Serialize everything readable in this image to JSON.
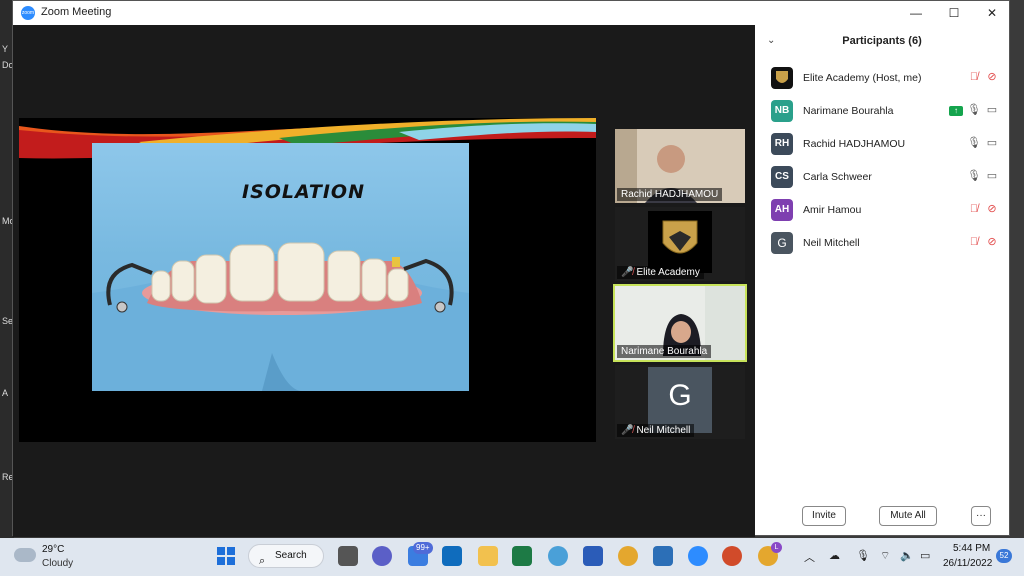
{
  "window": {
    "title": "Zoom Meeting",
    "logo_text": "zoom",
    "minimize": "—",
    "maximize": "☐",
    "close": "✕"
  },
  "desktop_labels": [
    "Y",
    "Do",
    "Mo",
    "Se",
    "A",
    "Re"
  ],
  "slide": {
    "title": "ISOLATION"
  },
  "video_tiles": [
    {
      "name": "Rachid HADJHAMOU",
      "muted": false
    },
    {
      "name": "Elite Academy",
      "muted": true
    },
    {
      "name": "Narimane Bourahla",
      "muted": false,
      "active": true
    },
    {
      "name": "Neil Mitchell",
      "muted": true,
      "initial": "G"
    }
  ],
  "participants_panel": {
    "title": "Participants (6)",
    "collapse_icon": "⌄",
    "items": [
      {
        "name": "Elite Academy (Host, me)",
        "initials": "",
        "color": "#111111",
        "mic": "muted",
        "video": "off"
      },
      {
        "name": "Narimane Bourahla",
        "initials": "NB",
        "color": "#2aa08b",
        "mic": "on",
        "video": "on",
        "sharing": true
      },
      {
        "name": "Rachid HADJHAMOU",
        "initials": "RH",
        "color": "#3c4a5a",
        "mic": "on",
        "video": "on"
      },
      {
        "name": "Carla Schweer",
        "initials": "CS",
        "color": "#3c4a5a",
        "mic": "on",
        "video": "on"
      },
      {
        "name": "Amir Hamou",
        "initials": "AH",
        "color": "#7e3fb0",
        "mic": "muted",
        "video": "off"
      },
      {
        "name": "Neil Mitchell",
        "initials": "G",
        "color": "#4a5560",
        "mic": "muted",
        "video": "off"
      }
    ],
    "invite_label": "Invite",
    "mute_all_label": "Mute All",
    "more_label": "···"
  },
  "taskbar": {
    "weather_temp": "29°C",
    "weather_condition": "Cloudy",
    "search_label": "Search",
    "mail_badge": "99+",
    "chrome_profile": "L",
    "time": "5:44 PM",
    "date": "26/11/2022",
    "notifications": "52"
  }
}
